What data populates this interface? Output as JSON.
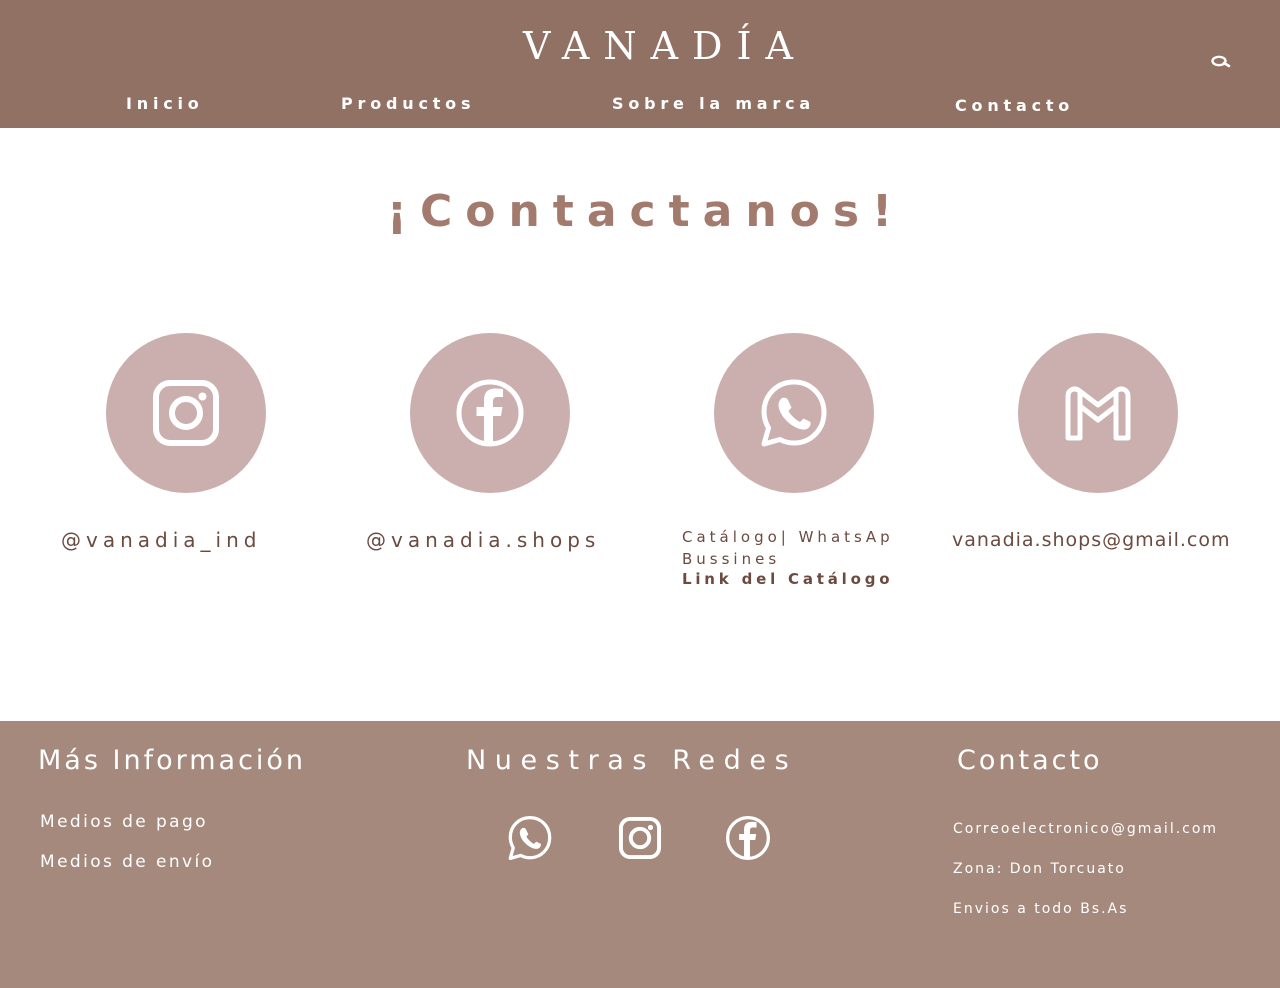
{
  "header": {
    "brand": "VANADÍA",
    "search_icon": "search-icon",
    "nav": [
      "Inicio",
      "Productos",
      "Sobre la marca",
      "Contacto"
    ]
  },
  "main": {
    "title": "¡Contactanos!",
    "contacts": [
      {
        "icon": "instagram-icon",
        "handle": "@vanadia_ind"
      },
      {
        "icon": "facebook-icon",
        "handle": "@vanadia.shops"
      },
      {
        "icon": "whatsapp-icon",
        "line1": "Catálogo| WhatsAp",
        "line2": "Bussines",
        "link": "Link del Catálogo"
      },
      {
        "icon": "gmail-icon",
        "handle": "vanadia.shops@gmail.com"
      }
    ]
  },
  "footer": {
    "info_heading": "Más Información",
    "info_links": [
      "Medios de pago",
      "Medios de envío"
    ],
    "social_heading": "Nuestras Redes",
    "social_icons": [
      "whatsapp-icon",
      "instagram-icon",
      "facebook-icon"
    ],
    "contact_heading": "Contacto",
    "contact_lines": [
      "Correoelectronico@gmail.com",
      "Zona: Don Torcuato",
      "Envios a todo Bs.As"
    ]
  },
  "colors": {
    "header_bg": "#917163",
    "title": "#a37a6e",
    "circle": "#cbaeae",
    "text_dark": "#6b4b40",
    "footer_bg": "#a5897c"
  }
}
